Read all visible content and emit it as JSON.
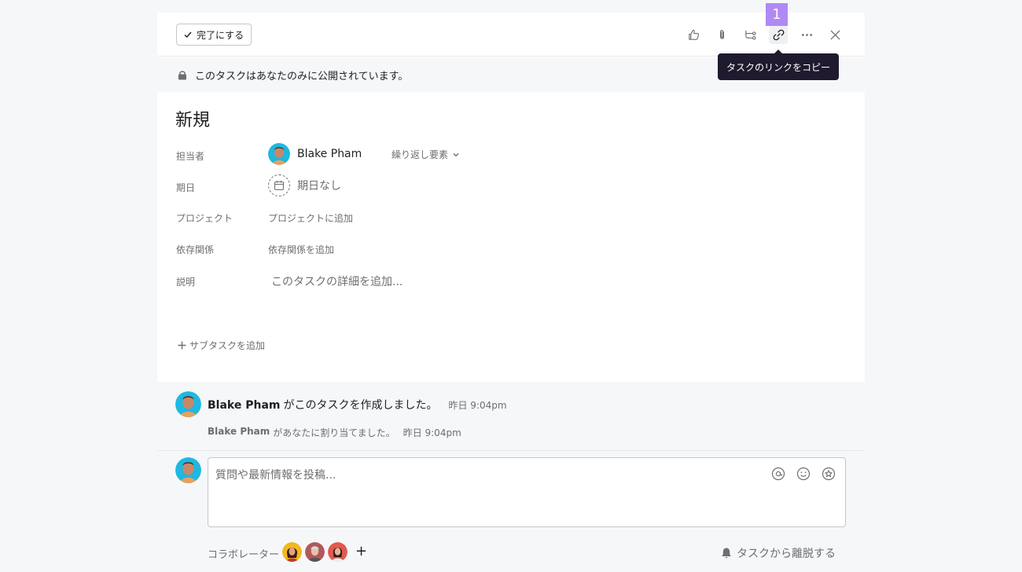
{
  "toolbar": {
    "complete_label": "完了にする",
    "badge_number": "1",
    "tooltip": "タスクのリンクをコピー",
    "icons": [
      "like-icon",
      "attachment-icon",
      "subtask-icon",
      "link-icon",
      "more-icon",
      "close-icon"
    ]
  },
  "privacy": {
    "text": "このタスクはあなたのみに公開されています。"
  },
  "task": {
    "title": "新規",
    "fields": {
      "assignee_label": "担当者",
      "assignee_name": "Blake Pham",
      "recurring_label": "繰り返し要素",
      "due_label": "期日",
      "due_value": "期日なし",
      "project_label": "プロジェクト",
      "project_value": "プロジェクトに追加",
      "dependency_label": "依存関係",
      "dependency_value": "依存関係を追加",
      "description_label": "説明",
      "description_placeholder": "このタスクの詳細を追加..."
    },
    "add_subtask": "サブタスクを追加"
  },
  "activity": {
    "creator": "Blake Pham",
    "created_text": "がこのタスクを作成しました。",
    "created_time": "昨日 9:04pm",
    "assigner": "Blake Pham",
    "assigned_text": "があなたに割り当てました。",
    "assigned_time": "昨日 9:04pm"
  },
  "comment": {
    "placeholder": "質問や最新情報を投稿...",
    "collaborators_label": "コラボレーター",
    "leave_label": "タスクから離脱する"
  },
  "colors": {
    "accent_badge": "#b089f5",
    "tooltip_bg": "#1f1a2e",
    "avatar_bg": "#1eb8e0"
  }
}
